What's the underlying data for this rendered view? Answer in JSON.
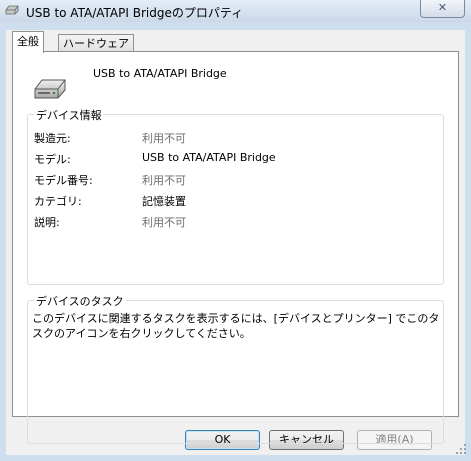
{
  "window": {
    "title": "USB to ATA/ATAPI Bridgeのプロパティ",
    "close_label": "✕"
  },
  "tabs": [
    {
      "label": "全般",
      "active": true
    },
    {
      "label": "ハードウェア",
      "active": false
    }
  ],
  "device": {
    "name": "USB to ATA/ATAPI Bridge",
    "icon": "drive-icon"
  },
  "device_info": {
    "caption": "デバイス情報",
    "rows": [
      {
        "label": "製造元:",
        "value": "利用不可",
        "available": false
      },
      {
        "label": "モデル:",
        "value": "USB to ATA/ATAPI Bridge",
        "available": true
      },
      {
        "label": "モデル番号:",
        "value": "利用不可",
        "available": false
      },
      {
        "label": "カテゴリ:",
        "value": "記憶装置",
        "available": true
      },
      {
        "label": "説明:",
        "value": "利用不可",
        "available": false
      }
    ]
  },
  "device_tasks": {
    "caption": "デバイスのタスク",
    "text": "このデバイスに関連するタスクを表示するには、[デバイスとプリンター] でこのタスクのアイコンを右クリックしてください。"
  },
  "buttons": {
    "ok": "OK",
    "cancel": "キャンセル",
    "apply": "適用(A)"
  }
}
